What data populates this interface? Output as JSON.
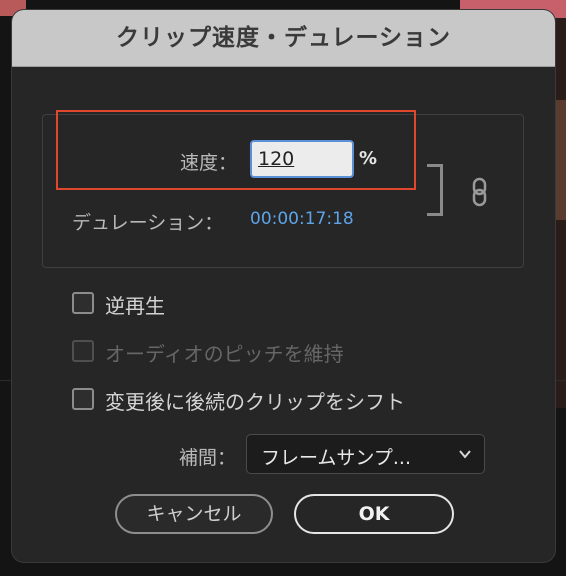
{
  "dialog": {
    "title": "クリップ速度・デュレーション",
    "speed": {
      "label": "速度：",
      "value": "120",
      "unit": "%"
    },
    "duration": {
      "label": "デュレーション：",
      "value": "00:00:17:18"
    },
    "options": [
      {
        "label": "逆再生",
        "checked": false,
        "enabled": true
      },
      {
        "label": "オーディオのピッチを維持",
        "checked": false,
        "enabled": false
      },
      {
        "label": "変更後に後続のクリップをシフト",
        "checked": false,
        "enabled": true
      }
    ],
    "interpolation": {
      "label": "補間：",
      "value": "フレームサンプ..."
    },
    "buttons": {
      "cancel": "キャンセル",
      "ok": "OK"
    }
  },
  "icons": {
    "link": "link-chain-icon",
    "dropdown": "chevron-down-icon"
  },
  "colors": {
    "highlight": "#e0472f",
    "duration_text": "#5ea3e8",
    "input_focus": "#5b8fd6"
  }
}
